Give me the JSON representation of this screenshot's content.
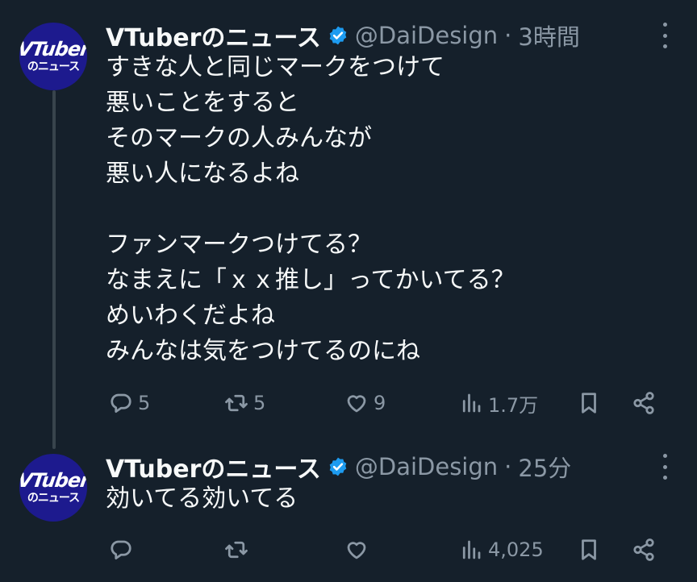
{
  "tweets": [
    {
      "avatar": {
        "line1": "VTuber",
        "line2": "のニュース"
      },
      "name": "VTuberのニュース",
      "handle": "@DaiDesign",
      "separator": "·",
      "time": "3時間",
      "text": "すきな人と同じマークをつけて\n悪いことをすると\nそのマークの人みんなが\n悪い人になるよね\n\nファンマークつけてる？\nなまえに「ｘｘ推し」ってかいてる？\nめいわくだよね\nみんなは気をつけてるのにね",
      "replies": "5",
      "retweets": "5",
      "likes": "9",
      "views": "1.7万"
    },
    {
      "avatar": {
        "line1": "VTuber",
        "line2": "のニュース"
      },
      "name": "VTuberのニュース",
      "handle": "@DaiDesign",
      "separator": "·",
      "time": "25分",
      "text": "効いてる効いてる",
      "replies": "",
      "retweets": "",
      "likes": "",
      "views": "4,025"
    }
  ],
  "icons": [
    "verified-badge-icon",
    "more-icon",
    "reply-icon",
    "retweet-icon",
    "like-icon",
    "views-icon",
    "bookmark-icon",
    "share-icon"
  ],
  "colors": {
    "background": "#15202b",
    "text": "#f7f9f9",
    "muted": "#8b98a5",
    "verified": "#1d9bf0",
    "avatar_bg": "#1d1a8e",
    "thread_line": "#38444d"
  }
}
